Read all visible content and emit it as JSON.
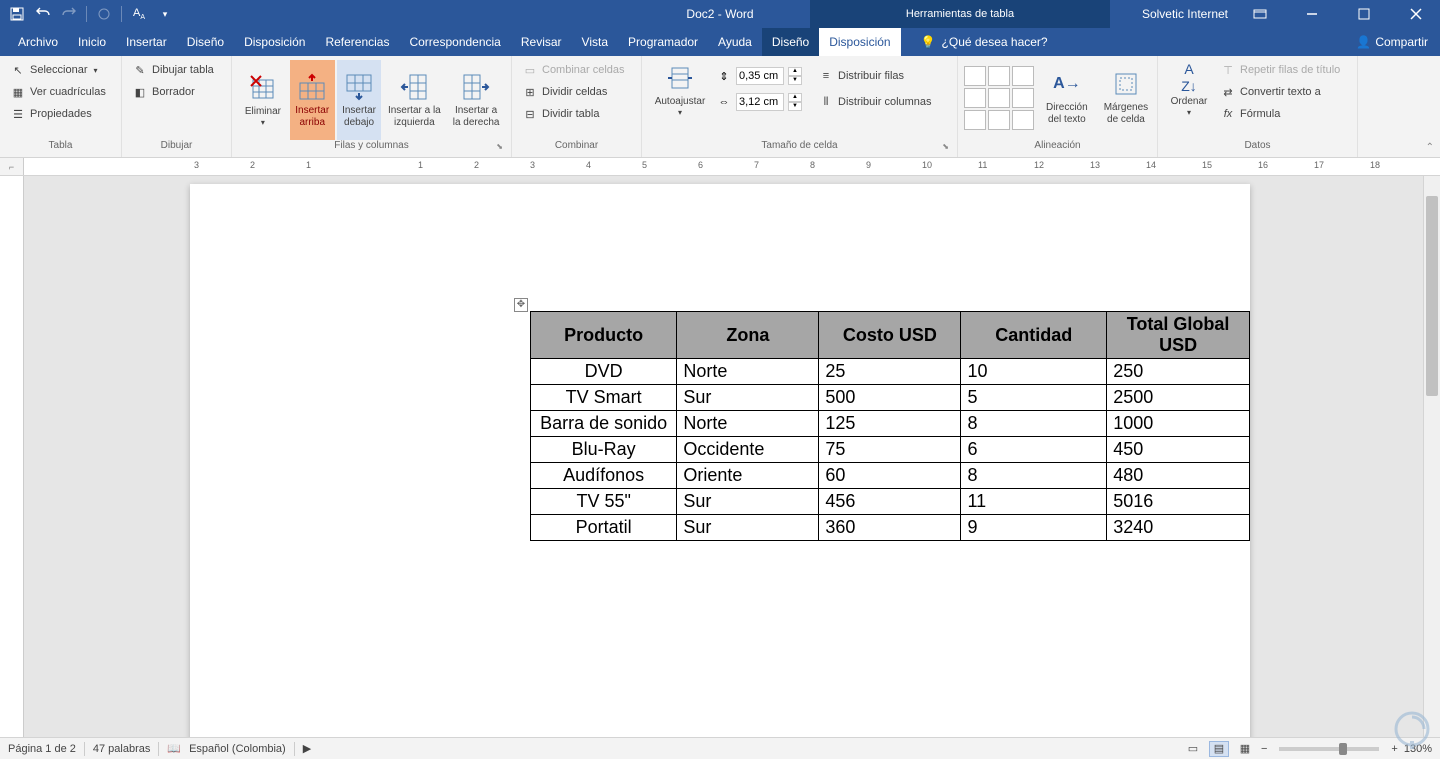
{
  "titlebar": {
    "doc": "Doc2 - Word",
    "context": "Herramientas de tabla",
    "user": "Solvetic Internet"
  },
  "menu": {
    "archivo": "Archivo",
    "inicio": "Inicio",
    "insertar": "Insertar",
    "diseno": "Diseño",
    "disposicion": "Disposición",
    "referencias": "Referencias",
    "correspondencia": "Correspondencia",
    "revisar": "Revisar",
    "vista": "Vista",
    "programador": "Programador",
    "ayuda": "Ayuda",
    "t_diseno": "Diseño",
    "t_disposicion": "Disposición",
    "tellme": "¿Qué desea hacer?",
    "compartir": "Compartir"
  },
  "ribbon": {
    "tabla": {
      "label": "Tabla",
      "seleccionar": "Seleccionar",
      "ver": "Ver cuadrículas",
      "prop": "Propiedades"
    },
    "dibujar": {
      "label": "Dibujar",
      "dibtab": "Dibujar tabla",
      "borrador": "Borrador"
    },
    "filcol": {
      "label": "Filas y columnas",
      "eliminar": "Eliminar",
      "ins_arriba": "Insertar arriba",
      "ins_debajo": "Insertar debajo",
      "ins_izq": "Insertar a la izquierda",
      "ins_der": "Insertar a la derecha"
    },
    "combinar": {
      "label": "Combinar",
      "combceldas": "Combinar celdas",
      "divceldas": "Dividir celdas",
      "divtabla": "Dividir tabla"
    },
    "tamano": {
      "label": "Tamaño de celda",
      "autoajustar": "Autoajustar",
      "alto": "0,35 cm",
      "ancho": "3,12 cm",
      "distfilas": "Distribuir filas",
      "distcol": "Distribuir columnas"
    },
    "alineacion": {
      "label": "Alineación",
      "dirtexto": "Dirección del texto",
      "margenes": "Márgenes de celda"
    },
    "ordenar": {
      "label": "Ordenar",
      "btn": "Ordenar"
    },
    "datos": {
      "label": "Datos",
      "repetir": "Repetir filas de título",
      "convertir": "Convertir texto a",
      "formula": "Fórmula"
    }
  },
  "table": {
    "headers": [
      "Producto",
      "Zona",
      "Costo USD",
      "Cantidad",
      "Total Global USD"
    ],
    "rows": [
      [
        "DVD",
        "Norte",
        "25",
        "10",
        "250"
      ],
      [
        "TV Smart",
        "Sur",
        "500",
        "5",
        "2500"
      ],
      [
        "Barra de sonido",
        "Norte",
        "125",
        "8",
        "1000"
      ],
      [
        "Blu-Ray",
        "Occidente",
        "75",
        "6",
        "450"
      ],
      [
        "Audífonos",
        "Oriente",
        "60",
        "8",
        "480"
      ],
      [
        "TV 55\"",
        "Sur",
        "456",
        "11",
        "5016"
      ],
      [
        "Portatil",
        "Sur",
        "360",
        "9",
        "3240"
      ]
    ]
  },
  "status": {
    "pagina": "Página 1 de 2",
    "palabras": "47 palabras",
    "idioma": "Español (Colombia)",
    "zoom": "130%"
  },
  "ruler": {
    "marks": [
      "3",
      "2",
      "1",
      "",
      "1",
      "2",
      "3",
      "4",
      "5",
      "6",
      "7",
      "8",
      "9",
      "10",
      "11",
      "12",
      "13",
      "14",
      "15",
      "16",
      "17",
      "18"
    ]
  }
}
